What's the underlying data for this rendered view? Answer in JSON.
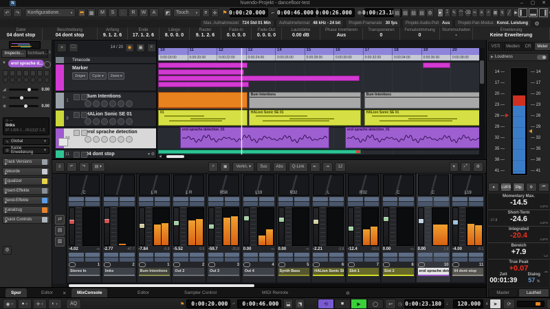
{
  "window": {
    "title": "Nuendo-Projekt - dancefloor-test",
    "minimize": "–",
    "maximize": "▢",
    "close": "✕",
    "logo": "N"
  },
  "toolbar": {
    "config": "Konfiguratione.",
    "automation_letters": [
      "M",
      "S",
      "L",
      "R",
      "W",
      "A"
    ],
    "automation_mode": "Touch",
    "times": {
      "left": "0:00:20.000",
      "right": "0:00:46.000",
      "length": "0:00:26.000",
      "position": "0:00:23.180"
    },
    "tools": [
      {
        "n": "object-selection",
        "g": "▸",
        "active": true
      },
      {
        "n": "range-selection",
        "g": "⌶"
      },
      {
        "n": "draw",
        "g": "✎"
      },
      {
        "n": "glue",
        "g": "⌒"
      },
      {
        "n": "erase",
        "g": "⌫"
      },
      {
        "n": "split",
        "g": "✂"
      },
      {
        "n": "mute",
        "g": "✕"
      },
      {
        "n": "zoom",
        "g": "⌕"
      },
      {
        "n": "comp",
        "g": "▦"
      },
      {
        "n": "time-warp",
        "g": "↯"
      },
      {
        "n": "line",
        "g": "╱"
      },
      {
        "n": "play",
        "g": "▶"
      },
      {
        "n": "scrub",
        "g": "∿"
      }
    ]
  },
  "info": {
    "stats": [
      {
        "label": "Max. Aufnahmezeit",
        "value": "724 Std 01 Min"
      },
      {
        "label": "Aufnahmeformat",
        "value": "48 kHz - 24 bit"
      },
      {
        "label": "Projekt-Framerate",
        "value": "30 fps"
      },
      {
        "label": "Projekt-Audio-Pull",
        "value": "Aus"
      },
      {
        "label": "Projekt-Pan-Modus",
        "value": "Konst. Leistung"
      }
    ],
    "fields": [
      {
        "label": "Datei",
        "value": "04 dont stop"
      },
      {
        "label": "Beschreibung",
        "value": "04 dont stop"
      },
      {
        "label": "Anfang",
        "value": "9. 1. 2. 6"
      },
      {
        "label": "Ende",
        "value": "17. 1. 2. 6"
      },
      {
        "label": "Länge",
        "value": "8. 0. 0. 0"
      },
      {
        "label": "Raster",
        "value": "9. 1. 2. 6"
      },
      {
        "label": "Fade-In",
        "value": "0. 0. 0. 0"
      },
      {
        "label": "Fade-Out",
        "value": "0. 0. 0. 0"
      },
      {
        "label": "Lautstärke",
        "value": "0.00  dB"
      },
      {
        "label": "Phase Invertieren",
        "value": "Aus"
      },
      {
        "label": "Transponieren",
        "value": "0"
      },
      {
        "label": "Feinabstimmung",
        "value": "0"
      },
      {
        "label": "Stummschalten",
        "value": "-"
      },
      {
        "label": "Erweiterung",
        "value": "Keine Erweiterung"
      }
    ]
  },
  "inspector": {
    "tab_inspector": "Inspecto...",
    "tab_visibility": "Sichtbark...",
    "track_name": "erol sprache d...",
    "volume": "0.00",
    "pan": "0.00",
    "routing_out": "links",
    "routing_detail": "87.1.826.1 ...051(1)[7.1.2]",
    "global": "Global",
    "extension": "Keine Erweiterung",
    "sections": [
      {
        "label": "Track Versions",
        "accent": "#9aa0a8"
      },
      {
        "label": "Akkorde",
        "accent": "#c8ccd2"
      },
      {
        "label": "Equalizer",
        "accent": "#e8d44c"
      },
      {
        "label": "Insert-Effekte",
        "accent": "#8a9098"
      },
      {
        "label": "Send-Effekte",
        "accent": "#5c9ce6"
      },
      {
        "label": "Kanalzug",
        "accent": "#e8822c"
      },
      {
        "label": "Quick Controls",
        "accent": "#b0b6be"
      }
    ],
    "tab_spur": "Spur",
    "tab_editor": "Editor"
  },
  "arrange": {
    "counter": "14 / 20",
    "ruler_bars": [
      "10",
      "11",
      "12",
      "13",
      "14",
      "15",
      "16",
      "17",
      "18",
      "19",
      "20"
    ],
    "ruler_times": [
      "0:00:18:00",
      "0:00:20:00",
      "0:00:22:00",
      "0:00:24:00",
      "0:00:26:00",
      "0:00:28:00",
      "0:00:30:00",
      "0:00:32:00",
      "0:00:34:00",
      "0:00:36:00",
      "0:00:38:00"
    ],
    "tracks": [
      {
        "name": "Timecode",
        "type": "timecode",
        "color": "#7a8088",
        "num": ""
      },
      {
        "name": "Marker",
        "type": "marker",
        "color": "#d23ad2",
        "num": "",
        "buttons": [
          "Zeigen",
          "Cycle",
          "Zoom"
        ]
      },
      {
        "name": "Bum Intentions",
        "type": "instrument",
        "color": "#9aa0a8",
        "num": "1"
      },
      {
        "name": "HALion Sonic SE 01",
        "type": "instrument",
        "color": "#ccd83a",
        "num": "8"
      },
      {
        "name": "erol sprache detection",
        "type": "audio",
        "color": "#a05ad0",
        "num": "10",
        "selected": true
      },
      {
        "name": "04 dont stop",
        "type": "audio",
        "color": "#2fc493",
        "num": "11"
      }
    ],
    "playhead_bar": 12.84,
    "markers": [
      {
        "start": 10,
        "end": 13.05,
        "row": 0
      },
      {
        "start": 19.05,
        "end": 20.0,
        "row": 0
      },
      {
        "start": 10,
        "end": 12.95,
        "row": 1
      },
      {
        "start": 10,
        "end": 16.9,
        "row": 2
      },
      {
        "start": 10,
        "end": 13.1,
        "row": 3
      }
    ],
    "clips": [
      {
        "lane": "bum",
        "start": 10,
        "end": 13.05,
        "kind": "orange",
        "label": ""
      },
      {
        "lane": "bum",
        "start": 13.1,
        "end": 16.95,
        "kind": "gray",
        "label": "Bum Intentions"
      },
      {
        "lane": "bum",
        "start": 17.05,
        "end": 21.25,
        "kind": "gray",
        "label": "Bum Intentions"
      },
      {
        "lane": "halion",
        "start": 10,
        "end": 13.05,
        "kind": "yellow",
        "label": "01"
      },
      {
        "lane": "halion",
        "start": 13.1,
        "end": 16.95,
        "kind": "yellow",
        "label": "HALion Sonic SE 01"
      },
      {
        "lane": "halion",
        "start": 17.05,
        "end": 21.25,
        "kind": "yellow",
        "label": "HALion Sonic SE 01"
      },
      {
        "lane": "erol",
        "start": 10.75,
        "end": 15.85,
        "kind": "purple",
        "label": "erol sprache detection_01"
      },
      {
        "lane": "erol",
        "start": 16.4,
        "end": 21.25,
        "kind": "purple",
        "label": "erol sprache detection_01"
      },
      {
        "lane": "dontstop",
        "start": 10,
        "end": 16.95,
        "kind": "teal",
        "label": ""
      }
    ]
  },
  "mixer": {
    "link": "Verkn.",
    "sus": "Sus",
    "abs": "Abs",
    "qlink": "Q-Link",
    "bank": "12",
    "channels": [
      {
        "name": "Stereo In",
        "num": "1",
        "pan": "C",
        "db": "-4.02",
        "peak": "-∞",
        "cap": "#d05454",
        "cap_pos": 0.32,
        "meter": [
          0,
          0
        ],
        "name_bg": "#3e4248",
        "name_fg": "#dddddd",
        "line": "#787d85"
      },
      {
        "name": "links",
        "num": "2",
        "pan": "",
        "db": "-2.77",
        "peak": "-47.7",
        "cap": "#d05454",
        "cap_pos": 0.3,
        "meter": [
          0.04,
          0
        ],
        "name_bg": "#3e4248",
        "name_fg": "#dddddd",
        "line": "#787d85"
      },
      {
        "name": "Bum Intentions",
        "num": "1",
        "pan": "L R",
        "db": "-7.84",
        "peak": "-0.8",
        "cap": "#cfc89c",
        "cap_pos": 0.42,
        "meter": [
          0.56,
          0.6
        ],
        "name_bg": "#43453a",
        "name_fg": "#dddddd",
        "line": "#8e9055"
      },
      {
        "name": "Out 2",
        "num": "2",
        "pan": "L R",
        "db": "-5.52",
        "peak": "0.0",
        "cap": "#a2cfa2",
        "cap_pos": 0.36,
        "meter": [
          0.66,
          0.7
        ],
        "name_bg": "#3e4248",
        "name_fg": "#dddddd",
        "line": "#6a6f76"
      },
      {
        "name": "Out 3",
        "num": "3",
        "pan": "R58",
        "db": "-59.7",
        "peak": "-20.8",
        "cap": "#a2cfa2",
        "cap_pos": 0.45,
        "meter": [
          0.74,
          0.78
        ],
        "name_bg": "#3e4248",
        "name_fg": "#dddddd",
        "line": "#6a6f76"
      },
      {
        "name": "Out 4",
        "num": "4",
        "pan": "L19",
        "db": "0.00",
        "peak": "-∞",
        "cap": "#a2cfa2",
        "cap_pos": 0.22,
        "meter": [
          0.26,
          0.42
        ],
        "name_bg": "#3e4248",
        "name_fg": "#dddddd",
        "line": "#6a6f76"
      },
      {
        "name": "Synth Bass",
        "num": "5",
        "pan": "R32",
        "db": "0.00",
        "peak": "-∞",
        "cap": "#a2cfa2",
        "cap_pos": 0.26,
        "meter": [
          0,
          0
        ],
        "name_bg": "#56572f",
        "name_fg": "#eeeeee",
        "line": "#93952f"
      },
      {
        "name": "HALion Sonic SE 01",
        "num": "6",
        "pan": "L",
        "db": "-2.21",
        "peak": "-3.8",
        "cap": "#d6d2a4",
        "cap_pos": 0.32,
        "meter": [
          0,
          0
        ],
        "name_bg": "#5e6026",
        "name_fg": "#eeeeee",
        "line": "#c7d123"
      },
      {
        "name": "Slot 1",
        "num": "7",
        "pan": "R32",
        "db": "-12.4",
        "peak": "-10.0",
        "cap": "#a2cfa2",
        "cap_pos": 0.5,
        "meter": [
          0.42,
          0.5
        ],
        "name_bg": "#676a28",
        "name_fg": "#eeeeee",
        "line": "#d3df25"
      },
      {
        "name": "Slot 2",
        "num": "8",
        "pan": "C",
        "db": "0.00",
        "peak": "-∞",
        "cap": "#a2cfa2",
        "cap_pos": 0.24,
        "meter": [
          0,
          0
        ],
        "name_bg": "#676a28",
        "name_fg": "#eeeeee",
        "line": "#d3df25"
      },
      {
        "name": "erol sprache detection",
        "num": "10",
        "pan": "C",
        "db": "0.00",
        "peak": "1.6",
        "cap": "#c2d4e6",
        "cap_pos": 0.3,
        "meter": [
          0.55
        ],
        "selected": true,
        "name_bg": "#e6e6e6",
        "name_fg": "#111111",
        "line": "#9a55cc"
      },
      {
        "name": "04 dont stop",
        "num": "11",
        "pan": "L19",
        "db": "-4.00",
        "peak": "-0.1",
        "cap": "#9fc3dd",
        "cap_pos": 0.34,
        "meter": [
          0.58,
          0.53
        ],
        "name_bg": "#56544e",
        "name_fg": "#dddddd",
        "line": "#8f8d85"
      }
    ]
  },
  "meter": {
    "tabs": [
      "VSTi",
      "Medien",
      "CR",
      "Meter"
    ],
    "active_tab": "Meter",
    "loudness": "Loudness",
    "scale": [
      "14",
      "17",
      "20",
      "23",
      "26",
      "29",
      "32",
      "35",
      "38",
      "41"
    ],
    "buttons": [
      "●",
      "LUFS",
      "Dlg.",
      "⚙",
      "⏮"
    ],
    "stats": [
      {
        "label": "Momentary Max.",
        "value": "-14.5",
        "unit": "LUFS",
        "red": false,
        "sub": ""
      },
      {
        "label": "Short-Term",
        "value": "-24.6",
        "unit": "LUFS",
        "red": false,
        "sub": "-17.8"
      },
      {
        "label": "Integrated",
        "value": "-20.4",
        "unit": "LUFS",
        "red": true,
        "sub": ""
      },
      {
        "label": "Bereich",
        "value": "+7.9",
        "unit": "LU",
        "red": false,
        "sub": ""
      },
      {
        "label": "True Peak",
        "value": "+0.07",
        "unit": "dB",
        "red": true,
        "sub": ""
      }
    ],
    "zeit_label": "Zeit",
    "zeit": "00:01:39",
    "dialog_label": "Dialog",
    "dialog": "57",
    "dialog_unit": "%",
    "tab_master": "Master",
    "tab_lautheit": "Lautheit"
  },
  "bottom": {
    "close": "✕",
    "tabs": [
      "MixConsole",
      "Editor",
      "Sampler Control",
      "MIDI Remote"
    ],
    "active": "MixConsole"
  },
  "transport": {
    "aq": "AQ",
    "left": "0:00:20.000",
    "right": "0:00:46.000",
    "position": "0:00:23.180",
    "tempo": "120.000"
  }
}
